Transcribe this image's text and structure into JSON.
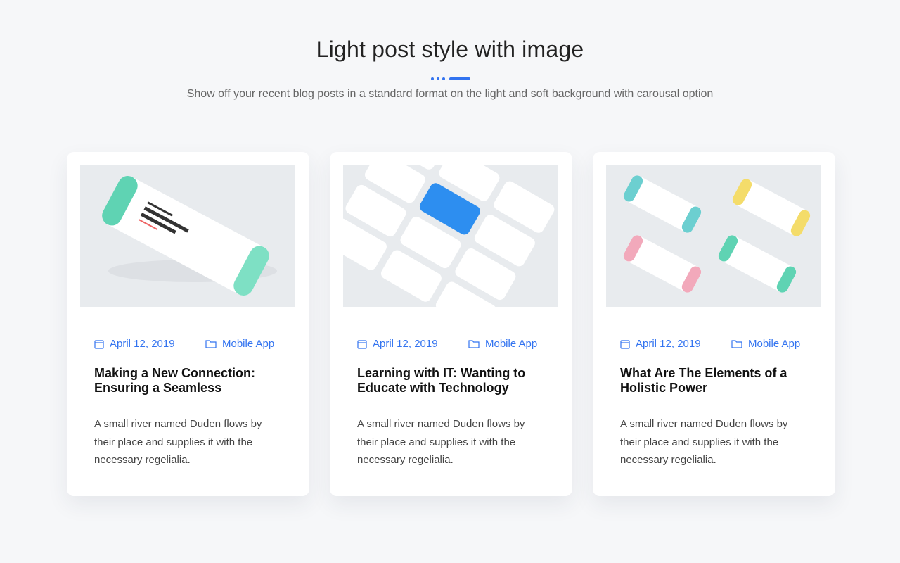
{
  "header": {
    "title": "Light post style with image",
    "subtitle": "Show off your recent blog posts in a standard format on the light and soft background with carousal option"
  },
  "colors": {
    "accent": "#3273f0",
    "background": "#f6f7f9",
    "card": "#ffffff"
  },
  "posts": [
    {
      "image": "single-phone-mockup-mint",
      "date": "April 12, 2019",
      "category": "Mobile App",
      "title": "Making a New Connection: Ensuring a Seamless",
      "excerpt": "A small river named Duden flows by their place and supplies it with the necessary regelialia."
    },
    {
      "image": "phone-grid-mockup-blue",
      "date": "April 12, 2019",
      "category": "Mobile App",
      "title": "Learning with IT: Wanting to Educate with Technology",
      "excerpt": "A small river named Duden flows by their place and supplies it with the necessary regelialia."
    },
    {
      "image": "four-phones-mockup-pastel",
      "date": "April 12, 2019",
      "category": "Mobile App",
      "title": "What Are The Elements of a Holistic Power",
      "excerpt": "A small river named Duden flows by their place and supplies it with the necessary regelialia."
    }
  ],
  "icons": {
    "date": "calendar-icon",
    "category": "folder-icon"
  }
}
